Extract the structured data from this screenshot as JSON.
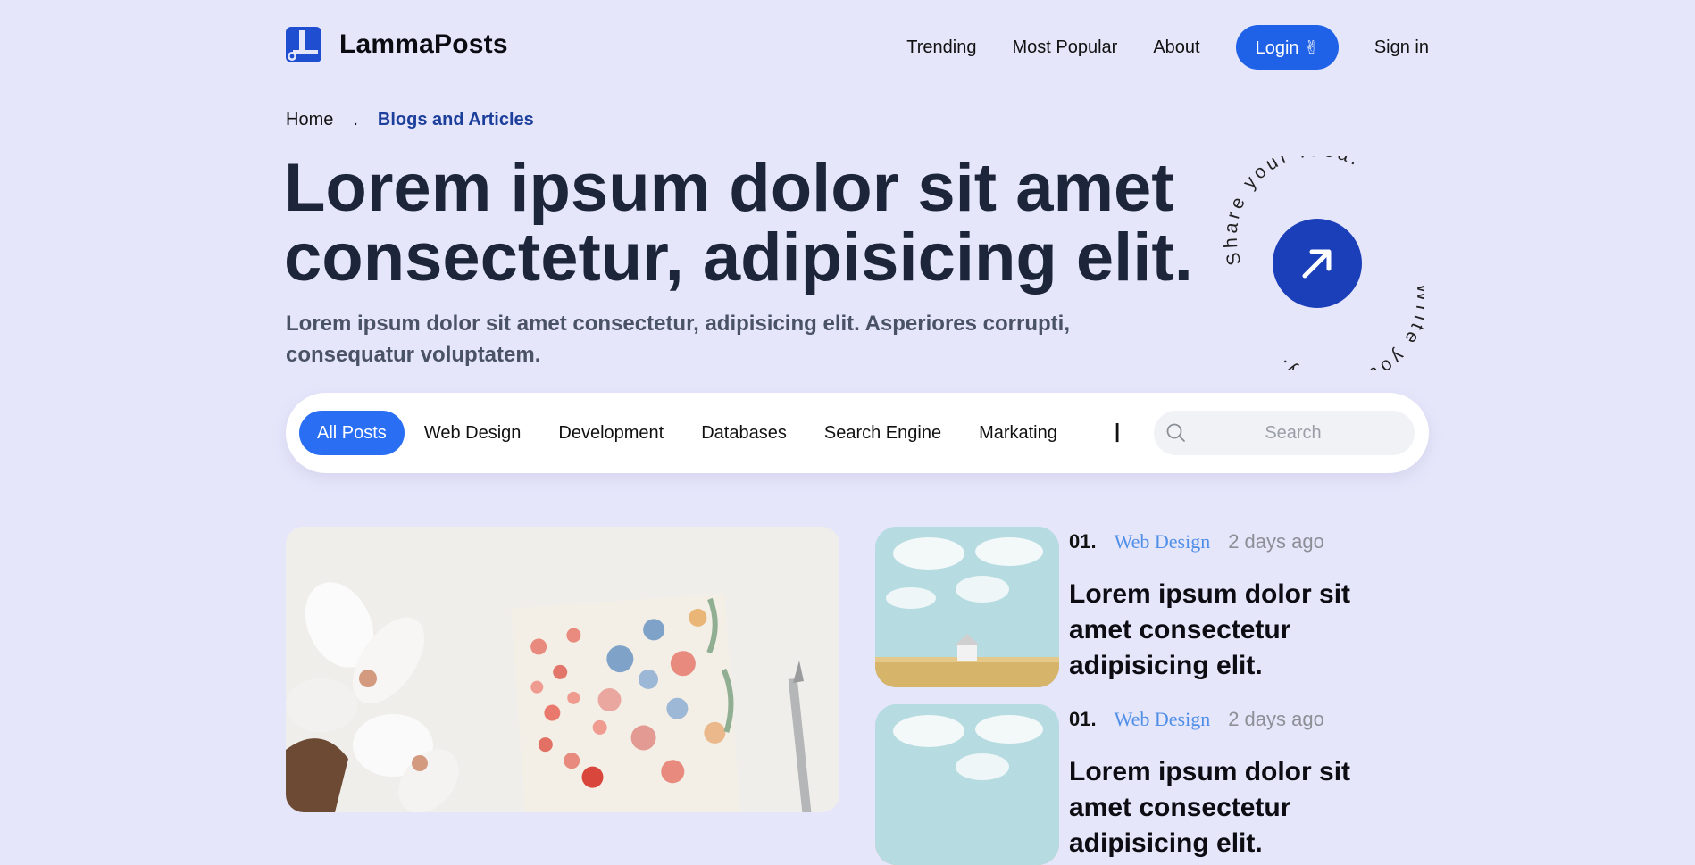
{
  "brand": {
    "name": "LammaPosts"
  },
  "nav": {
    "items": [
      "Trending",
      "Most Popular",
      "About"
    ],
    "login_label": "Login ✌",
    "signin_label": "Sign in"
  },
  "breadcrumb": {
    "home": "Home",
    "separator": ".",
    "current": "Blogs and Articles"
  },
  "hero": {
    "title": "Lorem ipsum dolor sit amet consectetur, adipisicing elit.",
    "subtitle": "Lorem ipsum dolor sit amet consectetur, adipisicing elit. Asperiores corrupti, consequatur voluptatem."
  },
  "badge": {
    "top_text": "Share your Idea.",
    "bottom_text": "Write your Story."
  },
  "filters": {
    "tabs": [
      "All Posts",
      "Web Design",
      "Development",
      "Databases",
      "Search Engine",
      "Markating"
    ],
    "active": "All Posts",
    "divider": "|",
    "search_placeholder": "Search"
  },
  "posts": [
    {
      "number": "01.",
      "category": "Web Design",
      "time": "2 days ago",
      "title": "Lorem ipsum dolor sit amet consectetur adipisicing elit."
    },
    {
      "number": "01.",
      "category": "Web Design",
      "time": "2 days ago",
      "title": "Lorem ipsum dolor sit amet consectetur adipisicing elit."
    }
  ],
  "colors": {
    "background": "#e6e6fb",
    "accent": "#1f62e8",
    "active_tab": "#2a6ff3",
    "badge_button": "#1b3fb9",
    "heading": "#1c2539",
    "category": "#4f8fe8"
  }
}
